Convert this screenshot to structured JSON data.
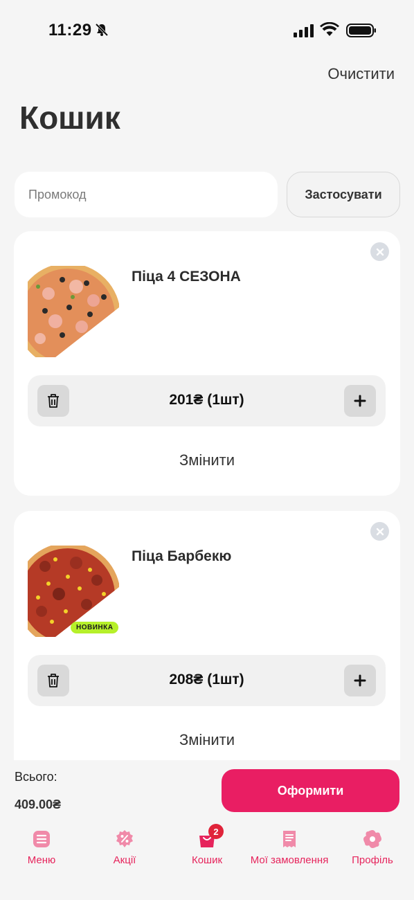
{
  "status_bar": {
    "time": "11:29"
  },
  "header": {
    "clear_label": "Очистити",
    "title": "Кошик"
  },
  "promo": {
    "placeholder": "Промокод",
    "apply_label": "Застосувати"
  },
  "cart_items": [
    {
      "name": "Піца 4 СЕЗОНА",
      "price_qty": "201₴ (1шт)",
      "edit_label": "Змінити",
      "badge": ""
    },
    {
      "name": "Піца Барбекю",
      "price_qty": "208₴ (1шт)",
      "edit_label": "Змінити",
      "badge": "НОВИНКА"
    }
  ],
  "summary": {
    "total_label": "Всього:",
    "total_value": "409.00₴",
    "checkout_label": "Оформити"
  },
  "tabs": [
    {
      "label": "Меню",
      "icon": "menu-list-icon"
    },
    {
      "label": "Акції",
      "icon": "discount-percent-icon"
    },
    {
      "label": "Кошик",
      "icon": "shopping-bag-icon",
      "badge": "2"
    },
    {
      "label": "Мої замовлення",
      "icon": "receipt-icon"
    },
    {
      "label": "Профіль",
      "icon": "profile-flower-icon"
    }
  ],
  "colors": {
    "accent": "#e91e63",
    "badge_new": "#b6f02a",
    "background": "#f5f5f5"
  }
}
